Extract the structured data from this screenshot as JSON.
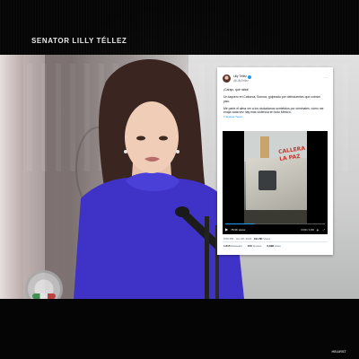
{
  "header": {
    "label": "SENATOR LILLY TÉLLEZ"
  },
  "credit": "HEARST",
  "tweet": {
    "author_name": "Lilly Téllez",
    "author_handle": "@LillyTellez",
    "paragraphs": [
      "¡Carajo, qué rabia!",
      "Un taquero en Caborca, Sonora, golpeado por delincuentes que cobran piso.",
      "Me parte el alma ver a los ciudadanos sometidos por criminales; cómo me enoja cada vez hay más violencia en todo México."
    ],
    "translate_label": "Translate Tweet",
    "video": {
      "views": "78,9K views",
      "time": "0:00 / 1:00",
      "graffiti": "CALLERA\nLA PAZ"
    },
    "meta": {
      "time": "6:06 PM · Jun 28, 2023",
      "views_count": "191.5K",
      "views_label": "Views"
    },
    "stats": [
      {
        "count": "1,615",
        "label": "Retweets"
      },
      {
        "count": "150",
        "label": "Quotes"
      },
      {
        "count": "3,398",
        "label": "Likes"
      }
    ]
  }
}
